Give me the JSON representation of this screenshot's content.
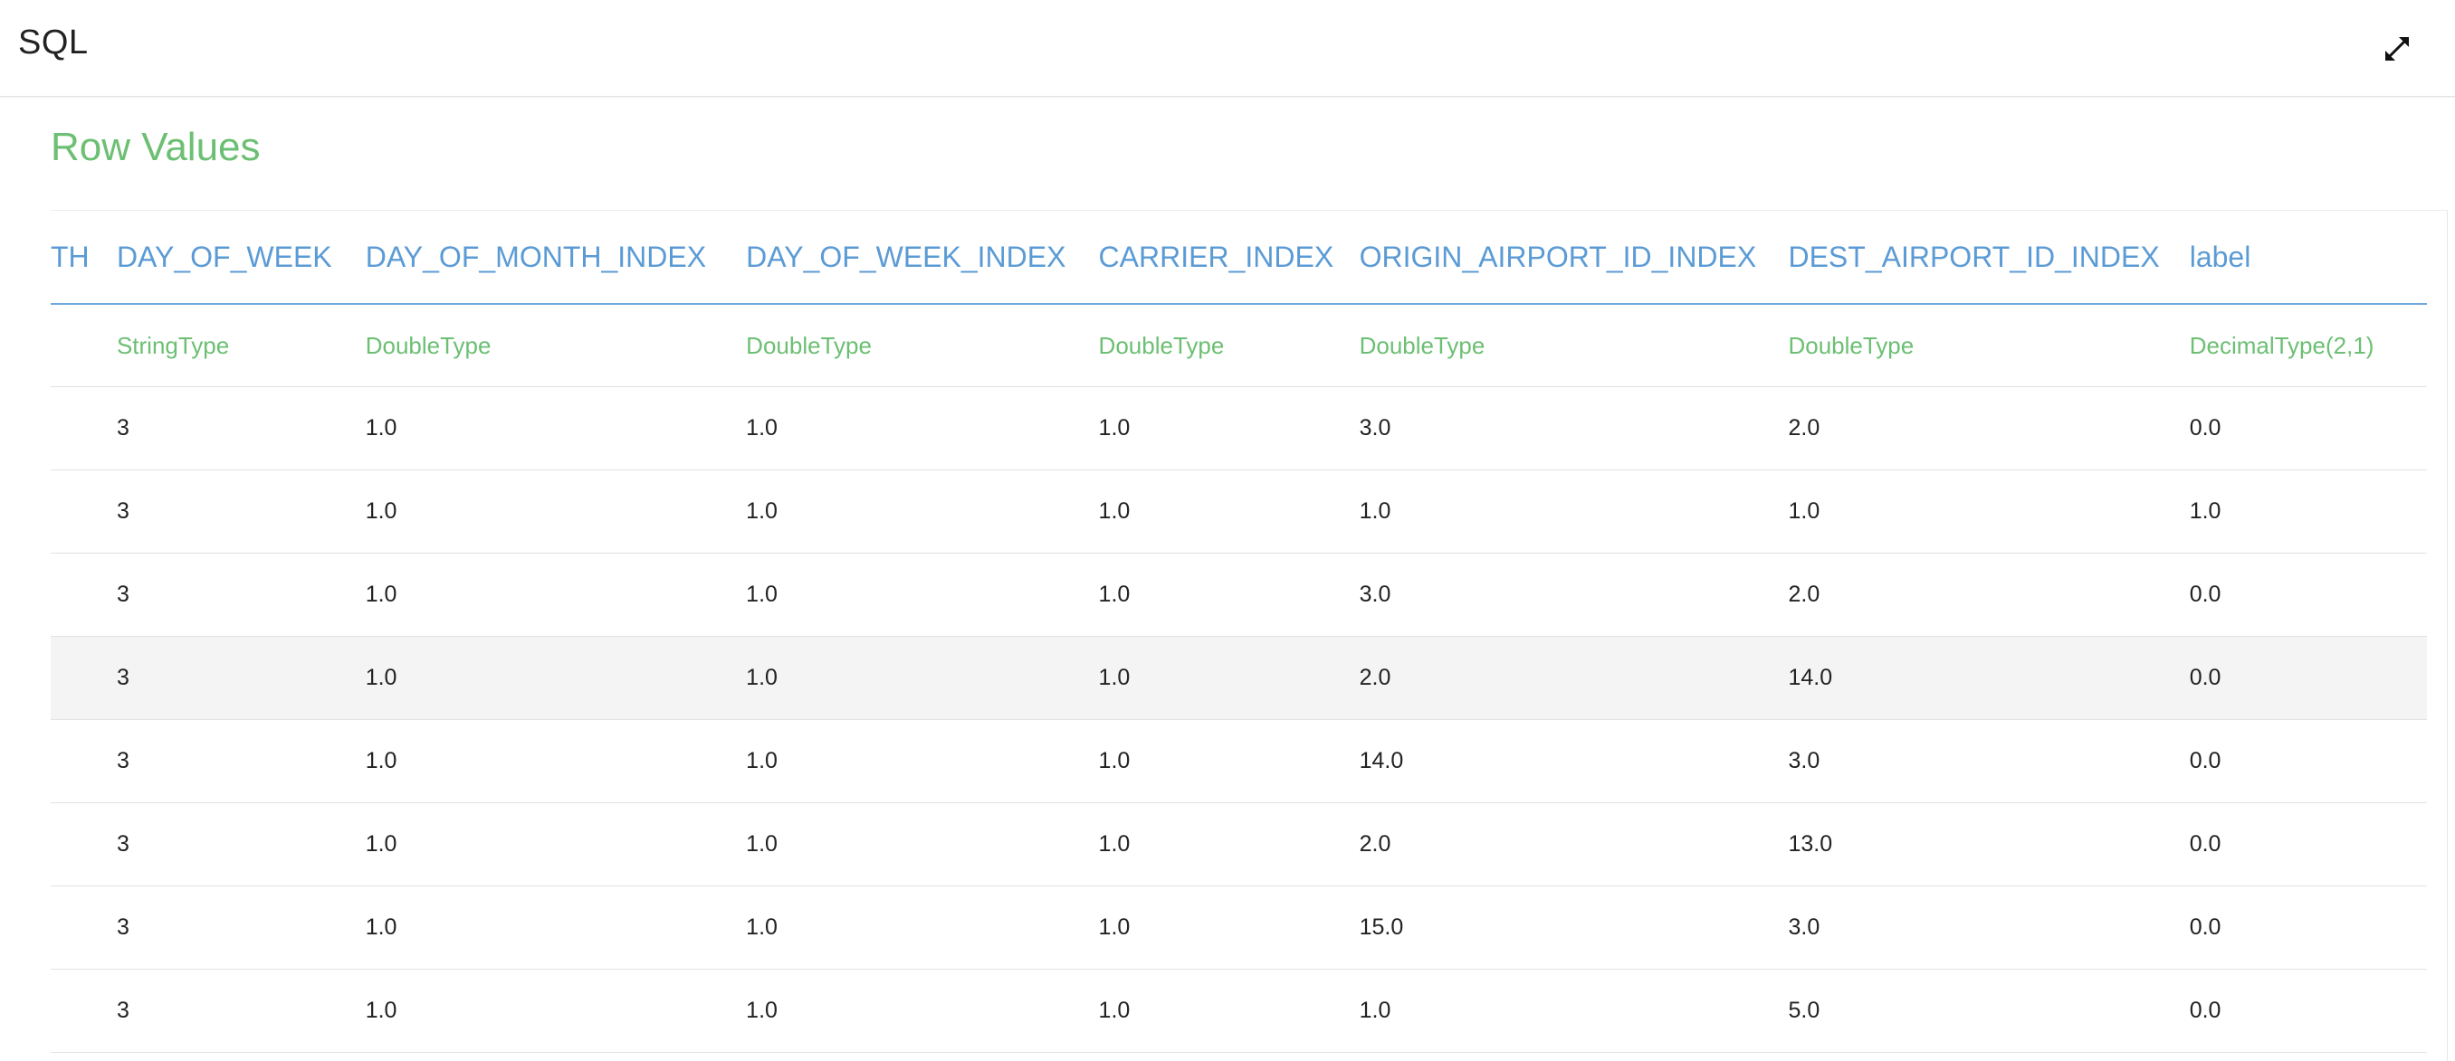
{
  "window": {
    "title": "SQL",
    "expand_icon": "expand-diagonal-arrows-icon"
  },
  "section": {
    "title": "Row Values"
  },
  "table": {
    "columns": [
      {
        "name": "TH",
        "type": ""
      },
      {
        "name": "DAY_OF_WEEK",
        "type": "StringType"
      },
      {
        "name": "DAY_OF_MONTH_INDEX",
        "type": "DoubleType"
      },
      {
        "name": "DAY_OF_WEEK_INDEX",
        "type": "DoubleType"
      },
      {
        "name": "CARRIER_INDEX",
        "type": "DoubleType"
      },
      {
        "name": "ORIGIN_AIRPORT_ID_INDEX",
        "type": "DoubleType"
      },
      {
        "name": "DEST_AIRPORT_ID_INDEX",
        "type": "DoubleType"
      },
      {
        "name": "label",
        "type": "DecimalType(2,1)"
      }
    ],
    "highlighted_row": 3,
    "rows": [
      [
        "",
        "3",
        "1.0",
        "1.0",
        "1.0",
        "3.0",
        "2.0",
        "0.0"
      ],
      [
        "",
        "3",
        "1.0",
        "1.0",
        "1.0",
        "1.0",
        "1.0",
        "1.0"
      ],
      [
        "",
        "3",
        "1.0",
        "1.0",
        "1.0",
        "3.0",
        "2.0",
        "0.0"
      ],
      [
        "",
        "3",
        "1.0",
        "1.0",
        "1.0",
        "2.0",
        "14.0",
        "0.0"
      ],
      [
        "",
        "3",
        "1.0",
        "1.0",
        "1.0",
        "14.0",
        "3.0",
        "0.0"
      ],
      [
        "",
        "3",
        "1.0",
        "1.0",
        "1.0",
        "2.0",
        "13.0",
        "0.0"
      ],
      [
        "",
        "3",
        "1.0",
        "1.0",
        "1.0",
        "15.0",
        "3.0",
        "0.0"
      ],
      [
        "",
        "3",
        "1.0",
        "1.0",
        "1.0",
        "1.0",
        "5.0",
        "0.0"
      ]
    ]
  },
  "colors": {
    "header_text": "#5b9bd5",
    "type_text": "#6cbf73",
    "section_title": "#6cbf73",
    "row_highlight": "#f4f4f4"
  }
}
